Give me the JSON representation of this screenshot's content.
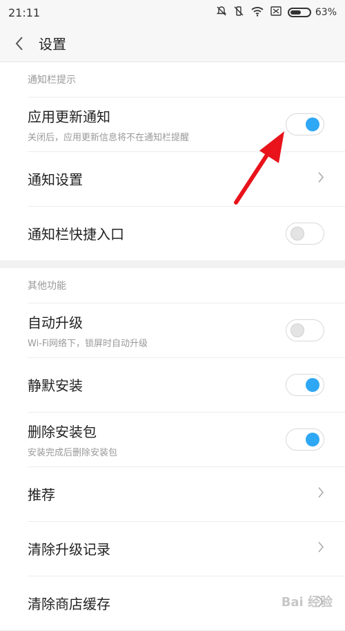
{
  "status": {
    "time": "21:11",
    "battery": "63%",
    "battery_level": 0.63,
    "icons": [
      "bell-off-icon",
      "vibrate-off-icon",
      "wifi-icon",
      "sim-icon",
      "battery-icon"
    ]
  },
  "appbar": {
    "back_icon": "chevron-left-icon",
    "title": "设置"
  },
  "sections": [
    {
      "header": "通知栏提示",
      "rows": [
        {
          "title": "应用更新通知",
          "subtitle": "关闭后，应用更新信息将不在通知栏提醒",
          "control": "toggle",
          "on": true
        },
        {
          "title": "通知设置",
          "control": "chevron"
        },
        {
          "title": "通知栏快捷入口",
          "control": "toggle",
          "on": false
        }
      ]
    },
    {
      "header": "其他功能",
      "rows": [
        {
          "title": "自动升级",
          "subtitle": "Wi-Fi网络下，锁屏时自动升级",
          "control": "toggle",
          "on": false
        },
        {
          "title": "静默安装",
          "control": "toggle",
          "on": true
        },
        {
          "title": "删除安装包",
          "subtitle": "安装完成后删除安装包",
          "control": "toggle",
          "on": true
        },
        {
          "title": "推荐",
          "control": "chevron"
        },
        {
          "title": "清除升级记录",
          "control": "chevron"
        },
        {
          "title": "清除商店缓存",
          "control": "chevron"
        }
      ]
    }
  ],
  "annotation": {
    "color": "#e8131b"
  },
  "watermark": "Bai 经验"
}
